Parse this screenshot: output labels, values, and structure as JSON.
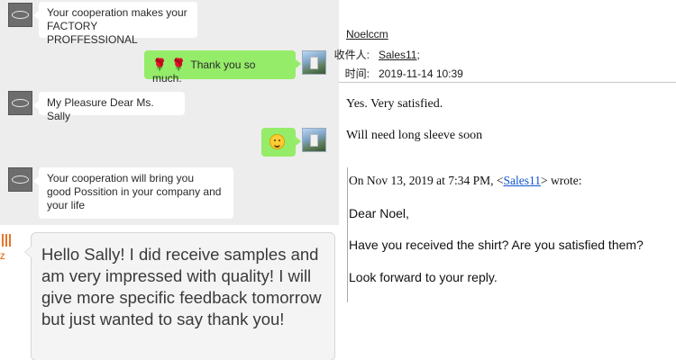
{
  "chat": {
    "messages": [
      {
        "text": "Your cooperation makes your\nFACTORY PROFFESSIONAL"
      },
      {
        "text": "Thank you so much."
      },
      {
        "text": "My Pleasure Dear Ms. Sally"
      },
      {
        "emoji": "smiling-face"
      },
      {
        "text": "Your cooperation will bring you\ngood Possition in your company and\nyour life"
      }
    ],
    "big_message": "Hello Sally! I did receive samples and am very impressed with quality! I will give more specific feedback tomorrow but just wanted to say thank you!",
    "big_avatar_text": "Z",
    "company_logo_text": "CPII"
  },
  "email": {
    "sender": "Noelccm",
    "recipient_label": "收件人:",
    "recipient": "Sales11",
    "recipient_suffix": ";",
    "time_label": "时间:",
    "time": "2019-11-14 10:39",
    "body": [
      "Yes. Very satisfied.",
      "Will need long sleeve soon"
    ],
    "quote": {
      "header_prefix": "On Nov 13, 2019 at 7:34 PM, <",
      "header_link": "Sales11",
      "header_suffix": "> wrote:",
      "lines": [
        "Dear Noel,",
        "Have you received the shirt? Are you satisfied them?",
        "Look forward to your reply."
      ]
    }
  }
}
